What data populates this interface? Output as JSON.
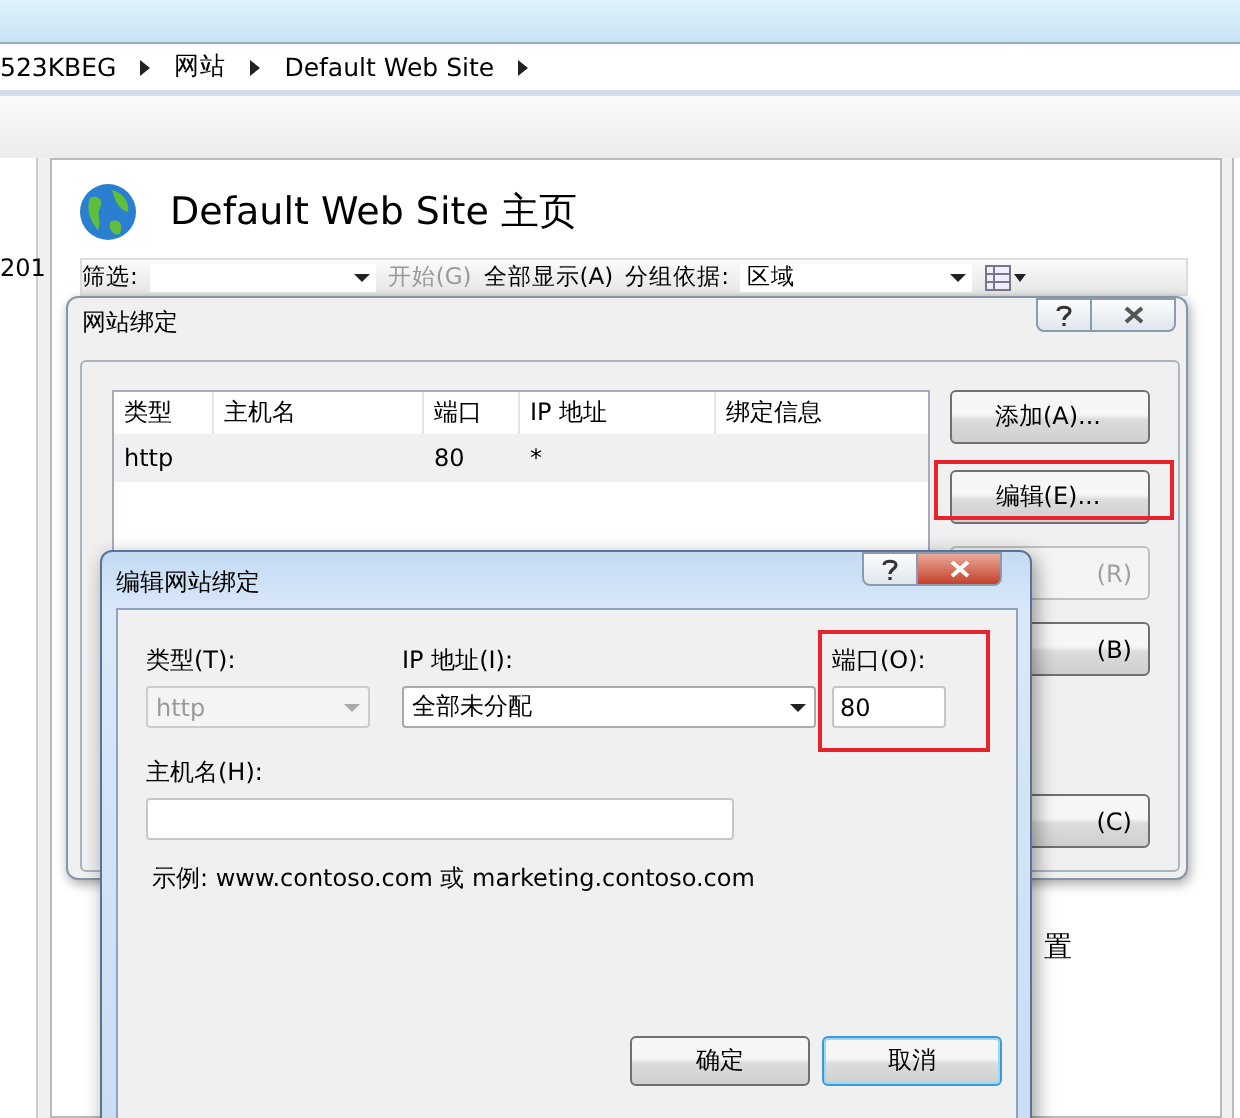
{
  "breadcrumb": [
    "523KBEG",
    "网站",
    "Default Web Site"
  ],
  "left_panel": {
    "text": "201"
  },
  "main": {
    "title": "Default Web Site 主页",
    "toolbar": {
      "filter_label": "筛选:",
      "start": {
        "label": "开始(G)",
        "disabled": true
      },
      "show_all": "全部显示(A)",
      "group_label": "分组依据:",
      "group_value": "区域"
    },
    "partial_text": "置"
  },
  "bindings_dialog": {
    "title": "网站绑定",
    "columns": [
      "类型",
      "主机名",
      "端口",
      "IP 地址",
      "绑定信息"
    ],
    "rows": [
      {
        "type": "http",
        "port": "80",
        "ip": "*",
        "selected": true
      }
    ],
    "buttons": [
      {
        "label": "添加(A)...",
        "disabled": false,
        "highlighted": false
      },
      {
        "label": "编辑(E)...",
        "disabled": false,
        "highlighted": true
      },
      {
        "label": "(R)",
        "disabled": true,
        "highlighted": false
      },
      {
        "label": "(B)",
        "disabled": false,
        "highlighted": false
      },
      {
        "label": "(C)",
        "disabled": false,
        "highlighted": false
      }
    ]
  },
  "edit_dialog": {
    "title": "编辑网站绑定",
    "type": {
      "label": "类型(T):",
      "value": "http",
      "disabled": true
    },
    "ip": {
      "label": "IP 地址(I):",
      "value": "全部未分配"
    },
    "port": {
      "label": "端口(O):",
      "value": "80",
      "highlighted": true
    },
    "host": {
      "label": "主机名(H):"
    },
    "example": "示例: www.contoso.com 或 marketing.contoso.com",
    "buttons": [
      {
        "label": "确定",
        "focused": false
      },
      {
        "label": "取消",
        "focused": true
      }
    ]
  }
}
